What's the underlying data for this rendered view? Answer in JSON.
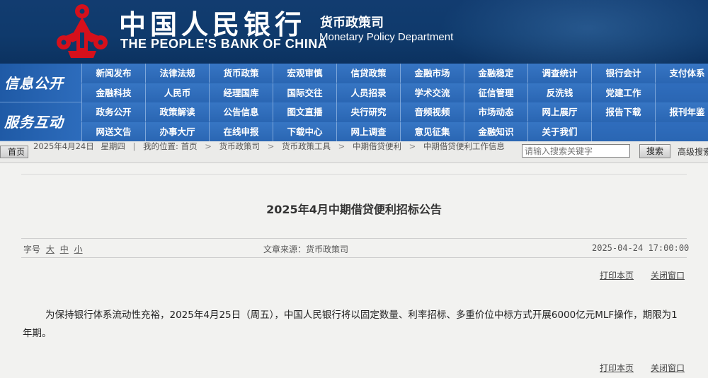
{
  "header": {
    "bank_name_cn": "中国人民银行",
    "bank_name_en": "THE PEOPLE'S BANK OF CHINA",
    "dept_cn": "货币政策司",
    "dept_en": "Monetary Policy Department",
    "colors": {
      "banner": "#0f3a6c",
      "emblem": "#d6101b",
      "nav": "#2a66b3"
    }
  },
  "nav": {
    "group1_label": "信息公开",
    "group2_label": "服务互动",
    "row1": [
      "新闻发布",
      "法律法规",
      "货币政策",
      "宏观审慎",
      "信贷政策",
      "金融市场",
      "金融稳定",
      "调查统计",
      "银行会计",
      "支付体系"
    ],
    "row2": [
      "金融科技",
      "人民币",
      "经理国库",
      "国际交往",
      "人员招录",
      "学术交流",
      "征信管理",
      "反洗钱",
      "党建工作",
      ""
    ],
    "row3": [
      "政务公开",
      "政策解读",
      "公告信息",
      "图文直播",
      "央行研究",
      "音频视频",
      "市场动态",
      "网上展厅",
      "报告下载",
      "报刊年鉴"
    ],
    "row4": [
      "网送文告",
      "办事大厅",
      "在线申报",
      "下载中心",
      "网上调查",
      "意见征集",
      "金融知识",
      "关于我们",
      "",
      ""
    ]
  },
  "breadcrumb": {
    "home_button": "首页",
    "date": "2025年4月24日",
    "weekday": "星期四",
    "location_label": "我的位置:",
    "items": [
      "首页",
      "货币政策司",
      "货币政策工具",
      "中期借贷便利",
      "中期借贷便利工作信息"
    ]
  },
  "search": {
    "placeholder": "请输入搜索关键字",
    "button": "搜索",
    "advanced": "高级搜索"
  },
  "article": {
    "title": "2025年4月中期借贷便利招标公告",
    "font_size_label": "字号",
    "font_large": "大",
    "font_medium": "中",
    "font_small": "小",
    "source": "文章来源：货币政策司",
    "date": "2025-04-24  17:00:00",
    "print": "打印本页",
    "close": "关闭窗口",
    "body": "为保持银行体系流动性充裕，2025年4月25日（周五），中国人民银行将以固定数量、利率招标、多重价位中标方式开展6000亿元MLF操作，期限为1年期。"
  }
}
